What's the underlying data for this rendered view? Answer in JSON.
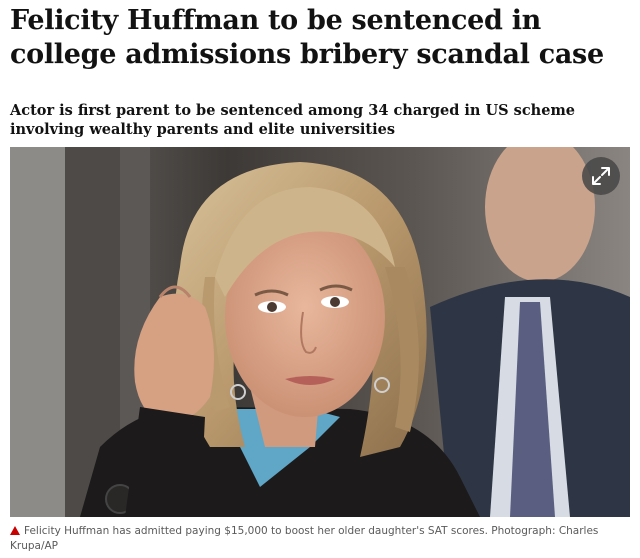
{
  "article": {
    "headline": "Felicity Huffman to be sentenced in college admissions bribery scandal case",
    "standfirst": "Actor is first parent to be sentenced among 34 charged in US scheme involving wealthy parents and elite universities"
  },
  "figure": {
    "caption": "Felicity Huffman has admitted paying $15,000 to boost her older daughter's SAT scores. Photograph: Charles Krupa/AP",
    "expand_icon": "expand-arrows-icon"
  },
  "colors": {
    "caption_triangle": "#c70000",
    "text": "#121212"
  }
}
